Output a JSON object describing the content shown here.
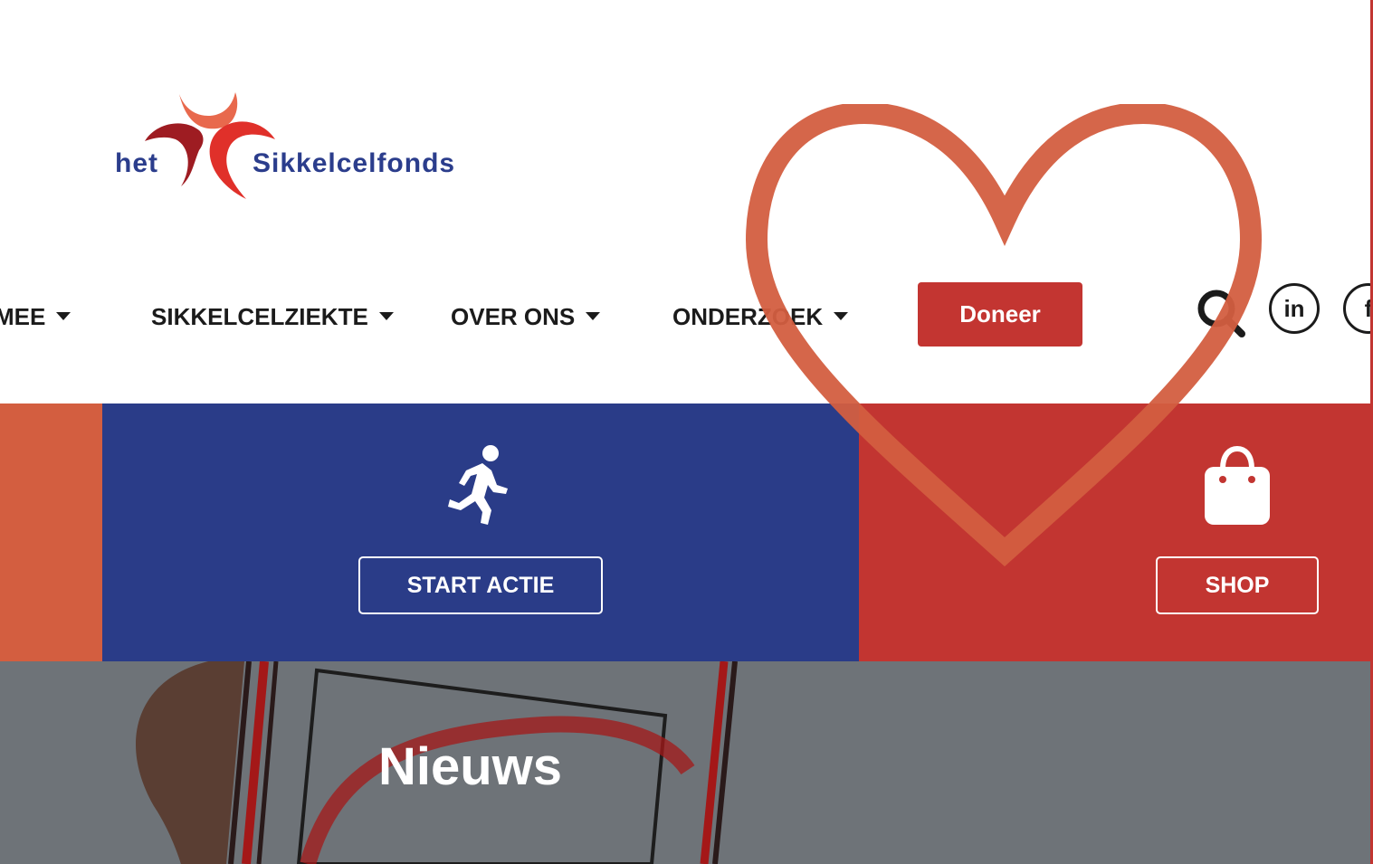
{
  "logo": {
    "prefix": "het",
    "name": "Sikkelcelfonds",
    "colors": {
      "dark_red": "#9e1c22",
      "red": "#e0302a",
      "orange": "#e8694d",
      "blue": "#2b3d8c"
    }
  },
  "nav": {
    "items": [
      {
        "label": "MEE",
        "has_dropdown": true
      },
      {
        "label": "SIKKELCELZIEKTE",
        "has_dropdown": true
      },
      {
        "label": "OVER ONS",
        "has_dropdown": true
      },
      {
        "label": "ONDERZOEK",
        "has_dropdown": true
      }
    ],
    "donate_label": "Doneer",
    "search_icon": "search-icon",
    "social": [
      {
        "icon": "linkedin-icon",
        "label": "in"
      },
      {
        "icon": "facebook-icon",
        "label": "f"
      }
    ]
  },
  "tiles": {
    "start": {
      "icon": "running-person-icon",
      "label": "START ACTIE"
    },
    "shop": {
      "icon": "shopping-bag-icon",
      "label": "SHOP"
    }
  },
  "news": {
    "title": "Nieuws"
  },
  "colors": {
    "accent_red": "#c33531",
    "accent_blue": "#2a3c88",
    "accent_orange": "#d35e40",
    "heart_outline": "#d35e40"
  }
}
